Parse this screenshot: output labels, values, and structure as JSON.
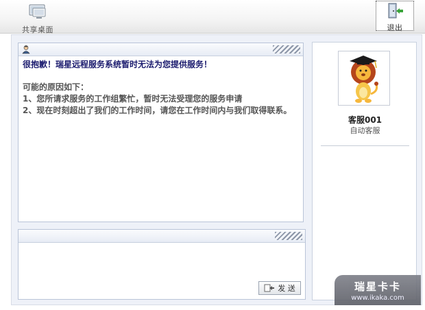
{
  "toolbar": {
    "share_label": "共享桌面",
    "exit_label": "退出"
  },
  "chat": {
    "title": "很抱歉！瑞星远程服务系统暂时无法为您提供服务！",
    "reasons_heading": "可能的原因如下：",
    "reason_1": "1、您所请求服务的工作组繁忙，暂时无法受理您的服务申请",
    "reason_2": "2、现在时刻超出了我们的工作时间，请您在工作时间内与我们取得联系。"
  },
  "input": {
    "send_label": "发 送"
  },
  "agent": {
    "name": "客服001",
    "role": "自动客服"
  },
  "watermark": {
    "brand": "瑞星卡卡",
    "url": "www.ikaka.com"
  },
  "icons": [
    "monitor-icon",
    "exit-door-icon",
    "user-icon",
    "send-icon",
    "lion-mascot"
  ],
  "colors": {
    "accent_navy": "#1b1b6e",
    "panel_border": "#b9c4d8",
    "frame_bg": "#eef1f8"
  }
}
